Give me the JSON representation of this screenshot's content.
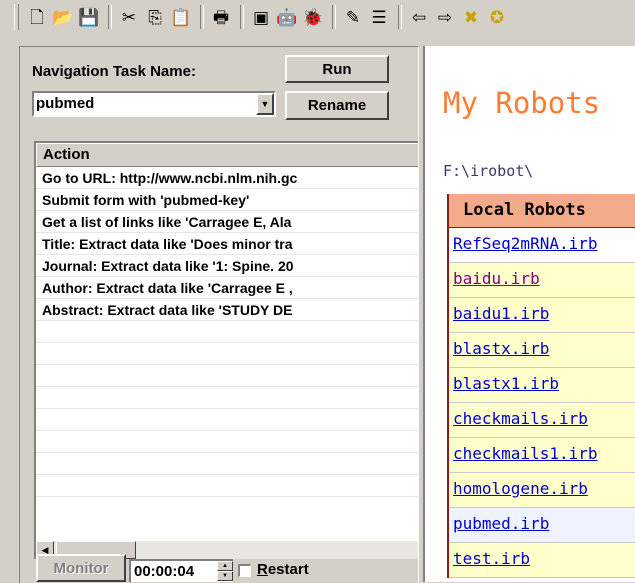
{
  "toolbar": {
    "icons": [
      "new-file-icon",
      "open-folder-icon",
      "save-icon",
      "cut-icon",
      "copy-icon",
      "paste-icon",
      "print-icon",
      "window-icon",
      "robot-run-icon",
      "robot-record-icon",
      "robot-wizard-icon",
      "robot-edit-icon",
      "back-arrow-icon",
      "forward-arrow-icon",
      "stop-icon",
      "refresh-icon"
    ],
    "glyphs": [
      "🗋",
      "📂",
      "💾",
      "✂",
      "⎘",
      "📋",
      "🖶",
      "▣",
      "🤖",
      "🐞",
      "✎",
      "☰",
      "⇦",
      "⇨",
      "✖",
      "✪"
    ]
  },
  "nav": {
    "task_name_label": "Navigation Task Name:",
    "run_label": "Run",
    "combo_value": "pubmed",
    "rename_label": "Rename"
  },
  "action_list": {
    "header": "Action",
    "rows": [
      "Go to URL: http://www.ncbi.nlm.nih.gc",
      "Submit form with 'pubmed-key'",
      "Get a list of links like 'Carragee E, Ala",
      "Title: Extract data like 'Does minor tra",
      "Journal: Extract data like '1: Spine. 20",
      "Author: Extract data like 'Carragee E ,",
      "Abstract: Extract data like 'STUDY DE"
    ]
  },
  "bottom": {
    "monitor_label": "Monitor",
    "timer_value": "00:00:04",
    "restart_label_pre": "",
    "restart_label_u": "R",
    "restart_label_post": "estart"
  },
  "robots": {
    "title": "My Robots",
    "path": "F:\\irobot\\",
    "table_header": "Local Robots",
    "items": [
      {
        "name": "RefSeq2mRNA.irb",
        "bg": "#ffffff",
        "color": "#0000cc"
      },
      {
        "name": "baidu.irb",
        "bg": "#ffffcc",
        "color": "#800080"
      },
      {
        "name": "baidu1.irb",
        "bg": "#ffffcc",
        "color": "#0000cc"
      },
      {
        "name": "blastx.irb",
        "bg": "#ffffcc",
        "color": "#0000cc"
      },
      {
        "name": "blastx1.irb",
        "bg": "#ffffcc",
        "color": "#0000cc"
      },
      {
        "name": "checkmails.irb",
        "bg": "#ffffcc",
        "color": "#0000cc"
      },
      {
        "name": "checkmails1.irb",
        "bg": "#ffffcc",
        "color": "#0000cc"
      },
      {
        "name": "homologene.irb",
        "bg": "#ffffcc",
        "color": "#0000cc"
      },
      {
        "name": "pubmed.irb",
        "bg": "#eef3ff",
        "color": "#0000cc"
      },
      {
        "name": "test.irb",
        "bg": "#ffffcc",
        "color": "#0000cc"
      }
    ]
  }
}
